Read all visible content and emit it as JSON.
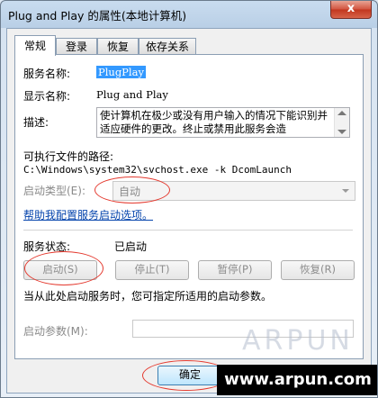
{
  "window": {
    "title": "Plug and Play 的属性(本地计算机)",
    "close_label": "x"
  },
  "tabs": [
    {
      "label": "常规"
    },
    {
      "label": "登录"
    },
    {
      "label": "恢复"
    },
    {
      "label": "依存关系"
    }
  ],
  "general": {
    "service_name_label": "服务名称:",
    "service_name_value": "PlugPlay",
    "display_name_label": "显示名称:",
    "display_name_value": "Plug and Play",
    "description_label": "描述:",
    "description_value": "使计算机在极少或没有用户输入的情况下能识别并适应硬件的更改。终止或禁用此服务会造",
    "exe_path_label": "可执行文件的路径:",
    "exe_path_value": "C:\\Windows\\system32\\svchost.exe -k DcomLaunch",
    "startup_type_label": "启动类型(E):",
    "startup_type_value": "自动",
    "help_link": "帮助我配置服务启动选项。",
    "service_status_label": "服务状态:",
    "service_status_value": "已启动",
    "buttons": {
      "start": "启动(S)",
      "stop": "停止(T)",
      "pause": "暂停(P)",
      "resume": "恢复(R)"
    },
    "hint_text": "当从此处启动服务时，您可指定所适用的启动参数。",
    "start_params_label": "启动参数(M):",
    "start_params_value": ""
  },
  "footer": {
    "ok_label": "确定"
  },
  "watermark": {
    "brand": "ARPUN",
    "url": "www.arpun.com"
  },
  "colors": {
    "annotation": "#e43a2f",
    "selection": "#3399ff",
    "link": "#0645ad"
  }
}
